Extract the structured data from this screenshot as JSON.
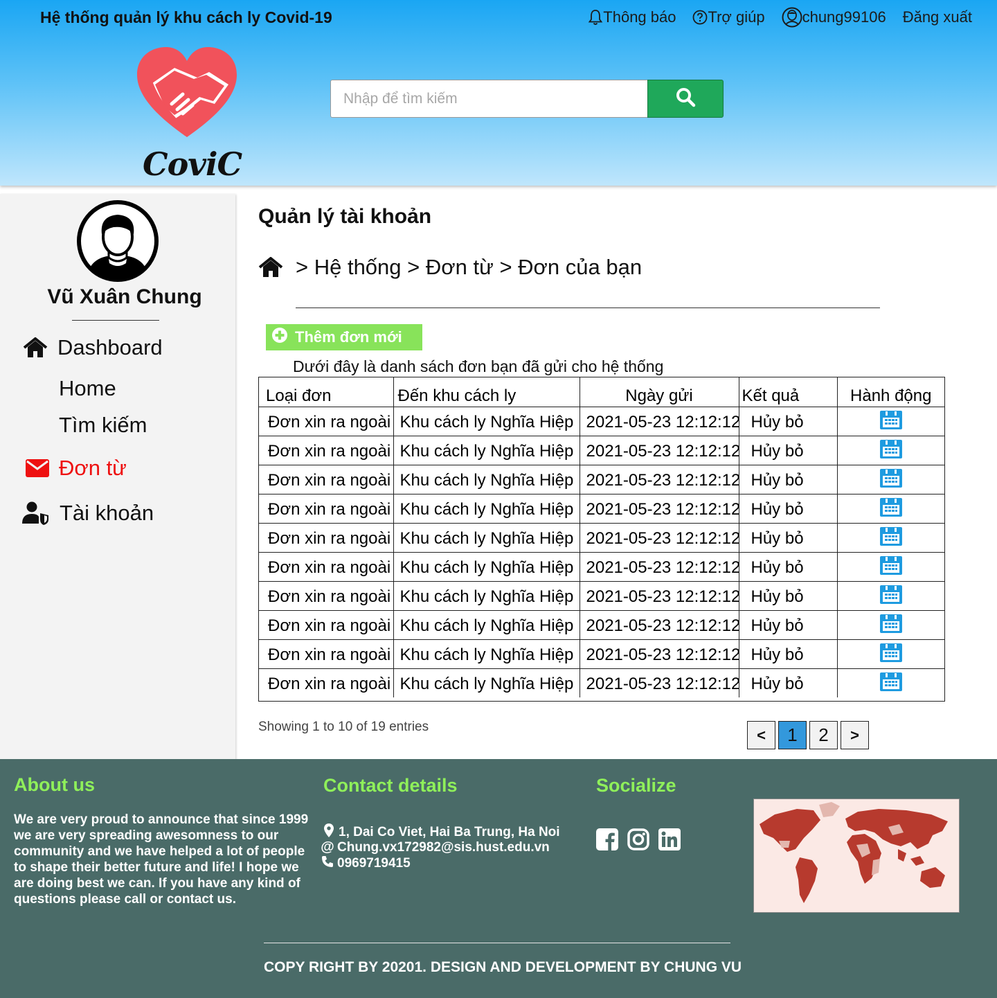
{
  "header": {
    "app_title": "Hệ thống quản lý khu cách  ly Covid-19",
    "logo_text": "CoviC",
    "nav": {
      "notifications": "Thông báo",
      "help": "Trợ giúp",
      "username": "chung99106",
      "logout": "Đăng xuất"
    },
    "search": {
      "placeholder": "Nhập để tìm kiếm",
      "value": ""
    }
  },
  "sidebar": {
    "user_name": "Vũ Xuân Chung",
    "menu": {
      "dashboard": "Dashboard",
      "home": "Home",
      "search": "Tìm kiếm",
      "forms": "Đơn từ",
      "account": "Tài khoản"
    }
  },
  "main": {
    "page_title": "Quản lý tài khoản",
    "breadcrumb": {
      "b1": "> Hệ thống",
      "b2": "> Đơn từ",
      "b3": "> Đơn của bạn"
    },
    "add_button": "Thêm đơn mới",
    "description": "Dưới đây là danh sách đơn bạn đã gửi cho hệ thống",
    "table": {
      "headers": {
        "type": "Loại đơn",
        "zone": "Đến khu cách ly",
        "date": "Ngày gửi",
        "result": "Kết quả",
        "action": "Hành động"
      },
      "rows": [
        {
          "type": "Đơn xin ra ngoài",
          "zone": "Khu cách ly Nghĩa Hiệp",
          "date": "2021-05-23 12:12:12",
          "result": "Hủy bỏ"
        },
        {
          "type": "Đơn xin ra ngoài",
          "zone": "Khu cách ly Nghĩa Hiệp",
          "date": "2021-05-23 12:12:12",
          "result": "Hủy bỏ"
        },
        {
          "type": "Đơn xin ra ngoài",
          "zone": "Khu cách ly Nghĩa Hiệp",
          "date": "2021-05-23 12:12:12",
          "result": "Hủy bỏ"
        },
        {
          "type": "Đơn xin ra ngoài",
          "zone": "Khu cách ly Nghĩa Hiệp",
          "date": "2021-05-23 12:12:12",
          "result": "Hủy bỏ"
        },
        {
          "type": "Đơn xin ra ngoài",
          "zone": "Khu cách ly Nghĩa Hiệp",
          "date": "2021-05-23 12:12:12",
          "result": "Hủy bỏ"
        },
        {
          "type": "Đơn xin ra ngoài",
          "zone": "Khu cách ly Nghĩa Hiệp",
          "date": "2021-05-23 12:12:12",
          "result": "Hủy bỏ"
        },
        {
          "type": "Đơn xin ra ngoài",
          "zone": "Khu cách ly Nghĩa Hiệp",
          "date": "2021-05-23 12:12:12",
          "result": "Hủy bỏ"
        },
        {
          "type": "Đơn xin ra ngoài",
          "zone": "Khu cách ly Nghĩa Hiệp",
          "date": "2021-05-23 12:12:12",
          "result": "Hủy bỏ"
        },
        {
          "type": "Đơn xin ra ngoài",
          "zone": "Khu cách ly Nghĩa Hiệp",
          "date": "2021-05-23 12:12:12",
          "result": "Hủy bỏ"
        },
        {
          "type": "Đơn xin ra ngoài",
          "zone": "Khu cách ly Nghĩa Hiệp",
          "date": "2021-05-23 12:12:12",
          "result": "Hủy bỏ"
        }
      ]
    },
    "showing": "Showing 1 to 10 of 19 entries",
    "pagination": {
      "prev": "<",
      "page1": "1",
      "page2": "2",
      "next": ">",
      "current_page": 1
    }
  },
  "footer": {
    "about_title": "About us",
    "about_text": "We are very proud to announce that since 1999 we are very spreading awesomness to our community and we have helped a lot of people to shape their better future and life! I hope we are doing best we can. If you have any kind of questions please call or contact us.",
    "contact_title": "Contact details",
    "address": "1, Dai Co Viet, Hai Ba Trung, Ha Noi",
    "email": "Chung.vx172982@sis.hust.edu.vn",
    "phone": "0969719415",
    "social_title": "Socialize",
    "social_icons": [
      "facebook-icon",
      "instagram-icon",
      "linkedin-icon"
    ],
    "copyright": "COPY RIGHT BY 20201. DESIGN AND DEVELOPMENT BY CHUNG VU"
  },
  "colors": {
    "header_top": "#1aa6f3",
    "search_button": "#1fa85a",
    "add_button": "#88e35a",
    "active_menu": "#ee1111",
    "current_page": "#3398dc",
    "footer_bg": "#4a6b68",
    "footer_heading": "#8ff05a",
    "calendar_icon": "#1e9be0"
  }
}
